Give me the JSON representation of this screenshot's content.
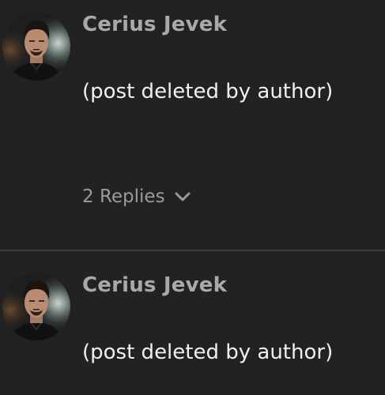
{
  "posts": [
    {
      "username": "Cerius Jevek",
      "body": "(post deleted by author)",
      "avatar": "character-portrait-avatar",
      "replies": {
        "label": "2 Replies",
        "icon": "chevron-down-icon"
      }
    },
    {
      "username": "Cerius Jevek",
      "body": "(post deleted by author)",
      "avatar": "character-portrait-avatar"
    }
  ],
  "colors": {
    "background": "#222222",
    "username": "#a9a9a9",
    "body_text": "#f0f0f0",
    "muted": "#9a9a9a",
    "divider": "#3b3b3b"
  }
}
